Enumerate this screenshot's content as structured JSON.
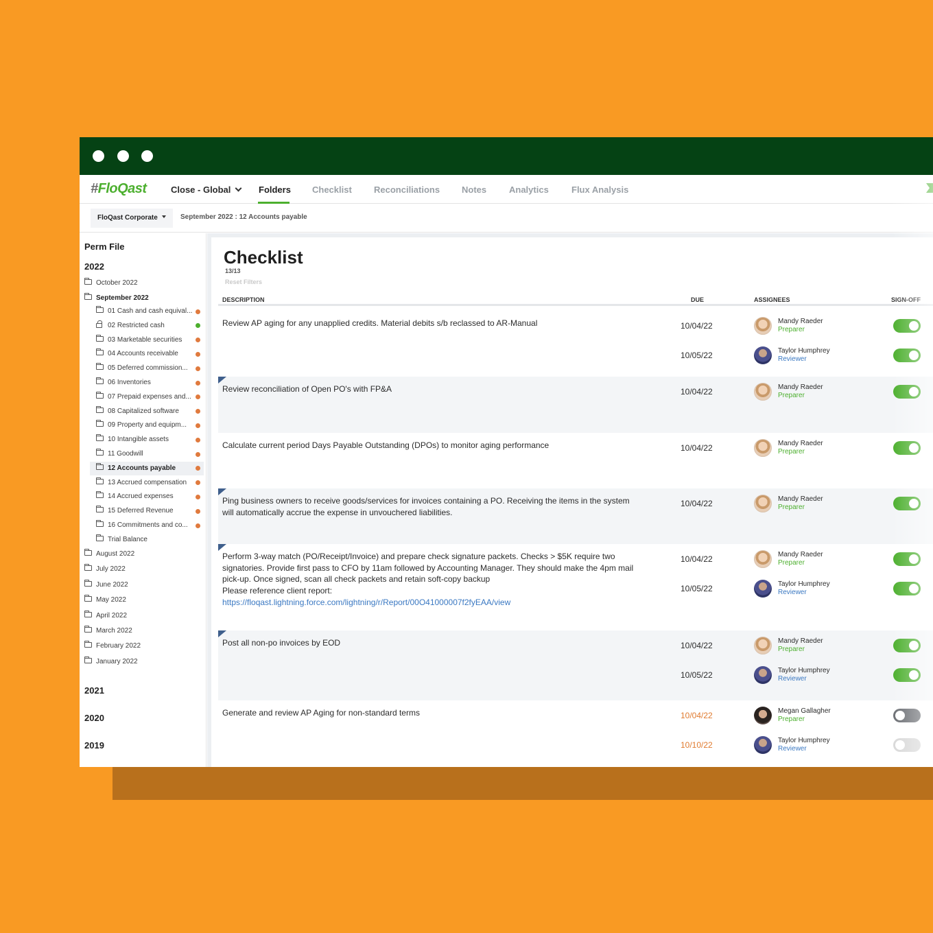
{
  "window": {
    "title_dots": [
      "dot",
      "dot",
      "dot"
    ],
    "colors": {
      "titlebar": "#054214",
      "accent": "#4CAF2E",
      "background": "#F99A23"
    }
  },
  "navbar": {
    "logo_hash": "#",
    "logo_text": "FloQast",
    "close_selector": "Close - Global",
    "items": [
      "Folders",
      "Checklist",
      "Reconciliations",
      "Notes",
      "Analytics",
      "Flux Analysis"
    ],
    "active": "Folders"
  },
  "subbar": {
    "entity": "FloQast Corporate",
    "breadcrumb": "September 2022 : 12 Accounts payable"
  },
  "sidebar": {
    "perm_file": "Perm File",
    "year_2022": "2022",
    "october": "October 2022",
    "september": "September 2022",
    "september_items": [
      {
        "label": "01 Cash and cash equival...",
        "status": "orange",
        "icon": "folder-icon"
      },
      {
        "label": "02 Restricted cash",
        "status": "green",
        "icon": "lock-icon"
      },
      {
        "label": "03 Marketable securities",
        "status": "orange",
        "icon": "folder-icon"
      },
      {
        "label": "04 Accounts receivable",
        "status": "orange",
        "icon": "folder-icon"
      },
      {
        "label": "05 Deferred commission...",
        "status": "orange",
        "icon": "folder-icon"
      },
      {
        "label": "06 Inventories",
        "status": "orange",
        "icon": "folder-icon"
      },
      {
        "label": "07 Prepaid expenses and...",
        "status": "orange",
        "icon": "folder-icon"
      },
      {
        "label": "08 Capitalized software",
        "status": "orange",
        "icon": "folder-icon"
      },
      {
        "label": "09 Property and equipm...",
        "status": "orange",
        "icon": "folder-icon"
      },
      {
        "label": "10 Intangible assets",
        "status": "orange",
        "icon": "folder-icon"
      },
      {
        "label": "11 Goodwill",
        "status": "orange",
        "icon": "folder-icon"
      },
      {
        "label": "12 Accounts payable",
        "status": "orange",
        "icon": "folder-icon"
      },
      {
        "label": "13 Accrued compensation",
        "status": "orange",
        "icon": "folder-icon"
      },
      {
        "label": "14 Accrued expenses",
        "status": "orange",
        "icon": "folder-icon"
      },
      {
        "label": "15 Deferred Revenue",
        "status": "orange",
        "icon": "folder-icon"
      },
      {
        "label": "16 Commitments and co...",
        "status": "orange",
        "icon": "folder-icon"
      },
      {
        "label": "Trial Balance",
        "status": "",
        "icon": "folder-icon"
      }
    ],
    "months": [
      "August 2022",
      "July 2022",
      "June 2022",
      "May 2022",
      "April 2022",
      "March 2022",
      "February 2022",
      "January 2022"
    ],
    "years": [
      "2021",
      "2020",
      "2019"
    ],
    "status_colors": {
      "orange": "#E07A3E",
      "green": "#4CAF2E"
    }
  },
  "checklist": {
    "title": "Checklist",
    "count": "13/13",
    "reset": "Reset Filters",
    "headers": {
      "description": "DESCRIPTION",
      "due": "DUE",
      "assignees": "ASSIGNEES",
      "signoff": "SIGN-OFF"
    },
    "rows": [
      {
        "description": "Review AP aging for any unapplied credits. Material debits s/b reclassed to AR-Manual",
        "flag": false,
        "assignees": [
          {
            "due": "10/04/22",
            "name": "Mandy Raeder",
            "role": "Preparer",
            "signoff": "on"
          },
          {
            "due": "10/05/22",
            "name": "Taylor Humphrey",
            "role": "Reviewer",
            "signoff": "on"
          }
        ]
      },
      {
        "description": "Review reconciliation of Open PO's with FP&A",
        "flag": true,
        "assignees": [
          {
            "due": "10/04/22",
            "name": "Mandy Raeder",
            "role": "Preparer",
            "signoff": "on"
          }
        ]
      },
      {
        "description": "Calculate current period Days Payable Outstanding (DPOs) to monitor aging performance",
        "flag": false,
        "assignees": [
          {
            "due": "10/04/22",
            "name": "Mandy Raeder",
            "role": "Preparer",
            "signoff": "on"
          }
        ]
      },
      {
        "description": "Ping business owners to receive goods/services for invoices containing a PO. Receiving the items in the system will automatically accrue the expense in unvouchered liabilities.",
        "flag": true,
        "assignees": [
          {
            "due": "10/04/22",
            "name": "Mandy Raeder",
            "role": "Preparer",
            "signoff": "on"
          }
        ]
      },
      {
        "description": "Perform 3-way match (PO/Receipt/Invoice) and prepare check signature packets. Checks > $5K require two signatories. Provide first pass to CFO by 11am followed by Accounting Manager. They should make the 4pm mail pick-up. Once signed, scan all check packets and retain soft-copy backup",
        "description_extra": "Please reference client report:",
        "link": "https://floqast.lightning.force.com/lightning/r/Report/00O41000007f2fyEAA/view",
        "flag": true,
        "assignees": [
          {
            "due": "10/04/22",
            "name": "Mandy Raeder",
            "role": "Preparer",
            "signoff": "on"
          },
          {
            "due": "10/05/22",
            "name": "Taylor Humphrey",
            "role": "Reviewer",
            "signoff": "on"
          }
        ]
      },
      {
        "description": "Post all non-po invoices by EOD",
        "flag": true,
        "assignees": [
          {
            "due": "10/04/22",
            "name": "Mandy Raeder",
            "role": "Preparer",
            "signoff": "on"
          },
          {
            "due": "10/05/22",
            "name": "Taylor Humphrey",
            "role": "Reviewer",
            "signoff": "on"
          }
        ]
      },
      {
        "description": "Generate and review AP Aging for non-standard terms",
        "flag": false,
        "assignees": [
          {
            "due": "10/04/22",
            "name": "Megan Gallagher",
            "role": "Preparer",
            "signoff": "off",
            "overdue": true
          },
          {
            "due": "10/10/22",
            "name": "Taylor Humphrey",
            "role": "Reviewer",
            "signoff": "disabled",
            "overdue": true
          }
        ]
      }
    ]
  }
}
